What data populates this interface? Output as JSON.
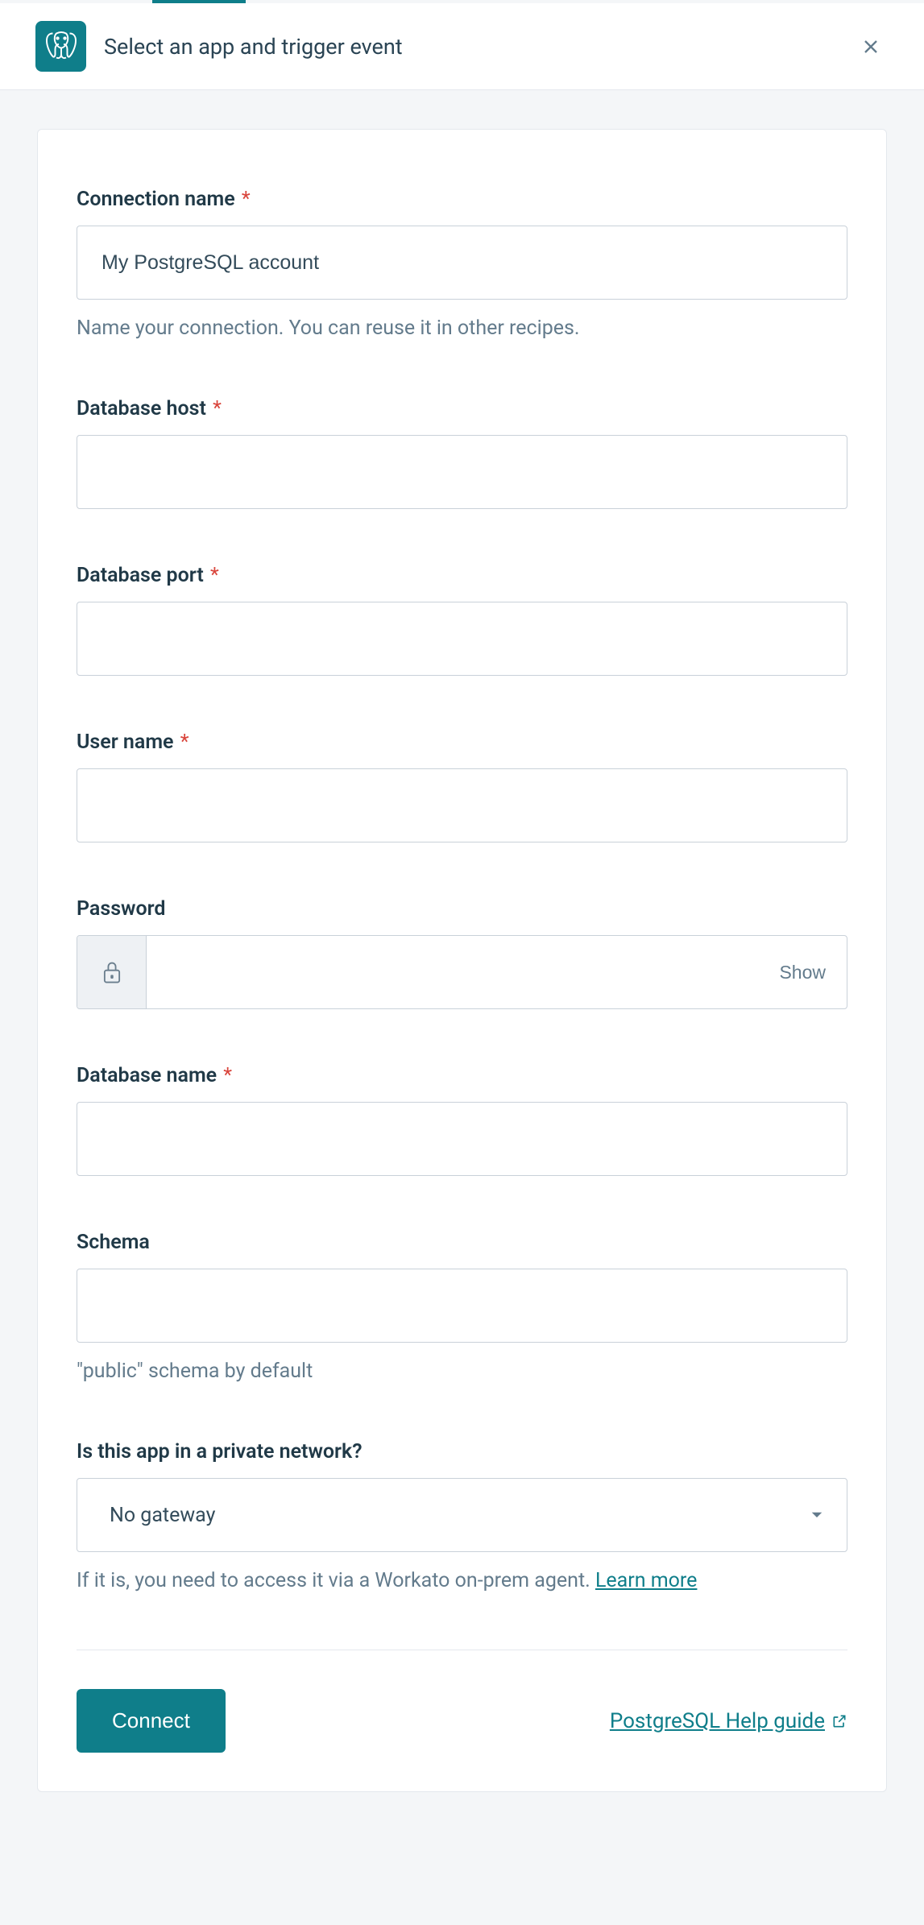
{
  "header": {
    "title": "Select an app and trigger event"
  },
  "form": {
    "connection_name": {
      "label": "Connection name",
      "value": "My PostgreSQL account",
      "helper": "Name your connection. You can reuse it in other recipes."
    },
    "database_host": {
      "label": "Database host",
      "value": ""
    },
    "database_port": {
      "label": "Database port",
      "value": ""
    },
    "user_name": {
      "label": "User name",
      "value": ""
    },
    "password": {
      "label": "Password",
      "value": "",
      "show_label": "Show"
    },
    "database_name": {
      "label": "Database name",
      "value": ""
    },
    "schema": {
      "label": "Schema",
      "value": "",
      "helper": "\"public\" schema by default"
    },
    "private_network": {
      "label": "Is this app in a private network?",
      "value": "No gateway",
      "helper_before": "If it is, you need to access it via a Workato on-prem agent. ",
      "helper_link": "Learn more"
    }
  },
  "footer": {
    "connect_label": "Connect",
    "help_link_label": "PostgreSQL Help guide"
  }
}
